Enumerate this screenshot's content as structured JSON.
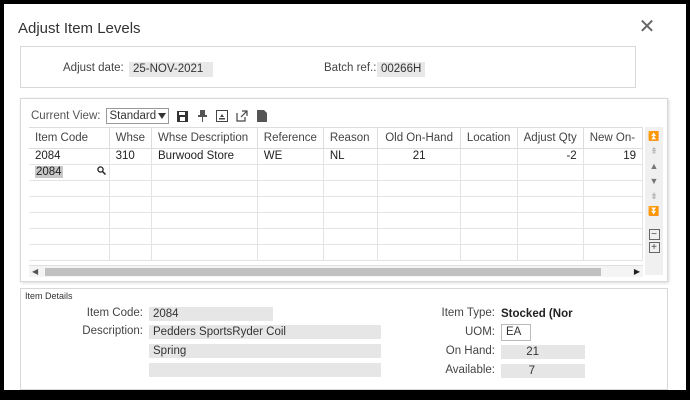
{
  "dialog": {
    "title": "Adjust Item Levels",
    "close_glyph": "✕"
  },
  "header": {
    "adjust_date_label": "Adjust date:",
    "adjust_date_value": "25-NOV-2021",
    "batch_ref_label": "Batch ref.:",
    "batch_ref_value": "00266H"
  },
  "toolbar": {
    "current_view_label": "Current View:",
    "view_value": "Standard",
    "icons": [
      "save-icon",
      "pin-icon",
      "export-icon",
      "popout-icon",
      "document-icon"
    ]
  },
  "grid": {
    "columns": [
      "Item Code",
      "Whse",
      "Whse Description",
      "Reference",
      "Reason",
      "Old On-Hand",
      "Location",
      "Adjust Qty",
      "New On-"
    ],
    "rows": [
      {
        "item_code": "2084",
        "whse": "310",
        "whse_description": "Burwood Store",
        "reference": "WE",
        "reason": "NL",
        "old_on_hand": "21",
        "location": "",
        "adjust_qty": "-2",
        "new_on_hand": "19"
      }
    ],
    "editing_row": {
      "item_code": "2084"
    }
  },
  "details": {
    "title": "Item Details",
    "item_code_label": "Item Code:",
    "item_code_value": "2084",
    "description_label": "Description:",
    "description_line1": "Pedders SportsRyder Coil",
    "description_line2": "Spring",
    "description_line3": "",
    "item_type_label": "Item Type:",
    "item_type_value": "Stocked (Nor",
    "uom_label": "UOM:",
    "uom_value": "EA",
    "on_hand_label": "On Hand:",
    "on_hand_value": "21",
    "available_label": "Available:",
    "available_value": "7"
  }
}
